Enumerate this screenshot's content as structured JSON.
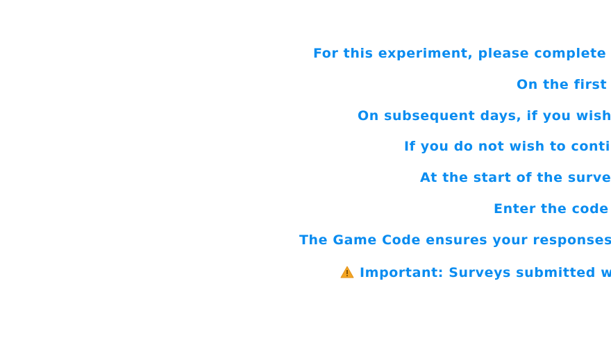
{
  "instructions": {
    "lines": [
      "For this experiment, please complete the",
      "On the first da",
      "On subsequent days, if you wish to",
      "If you do not wish to continue",
      "At the start of the survey, y",
      "Enter the code e",
      "The Game Code ensures your responses ar"
    ],
    "warning": {
      "icon": "warning-icon",
      "text": "Important: Surveys submitted witho"
    }
  },
  "colors": {
    "text": "#0a8cf0",
    "warning_icon": "#f5a623",
    "background": "#ffffff"
  }
}
